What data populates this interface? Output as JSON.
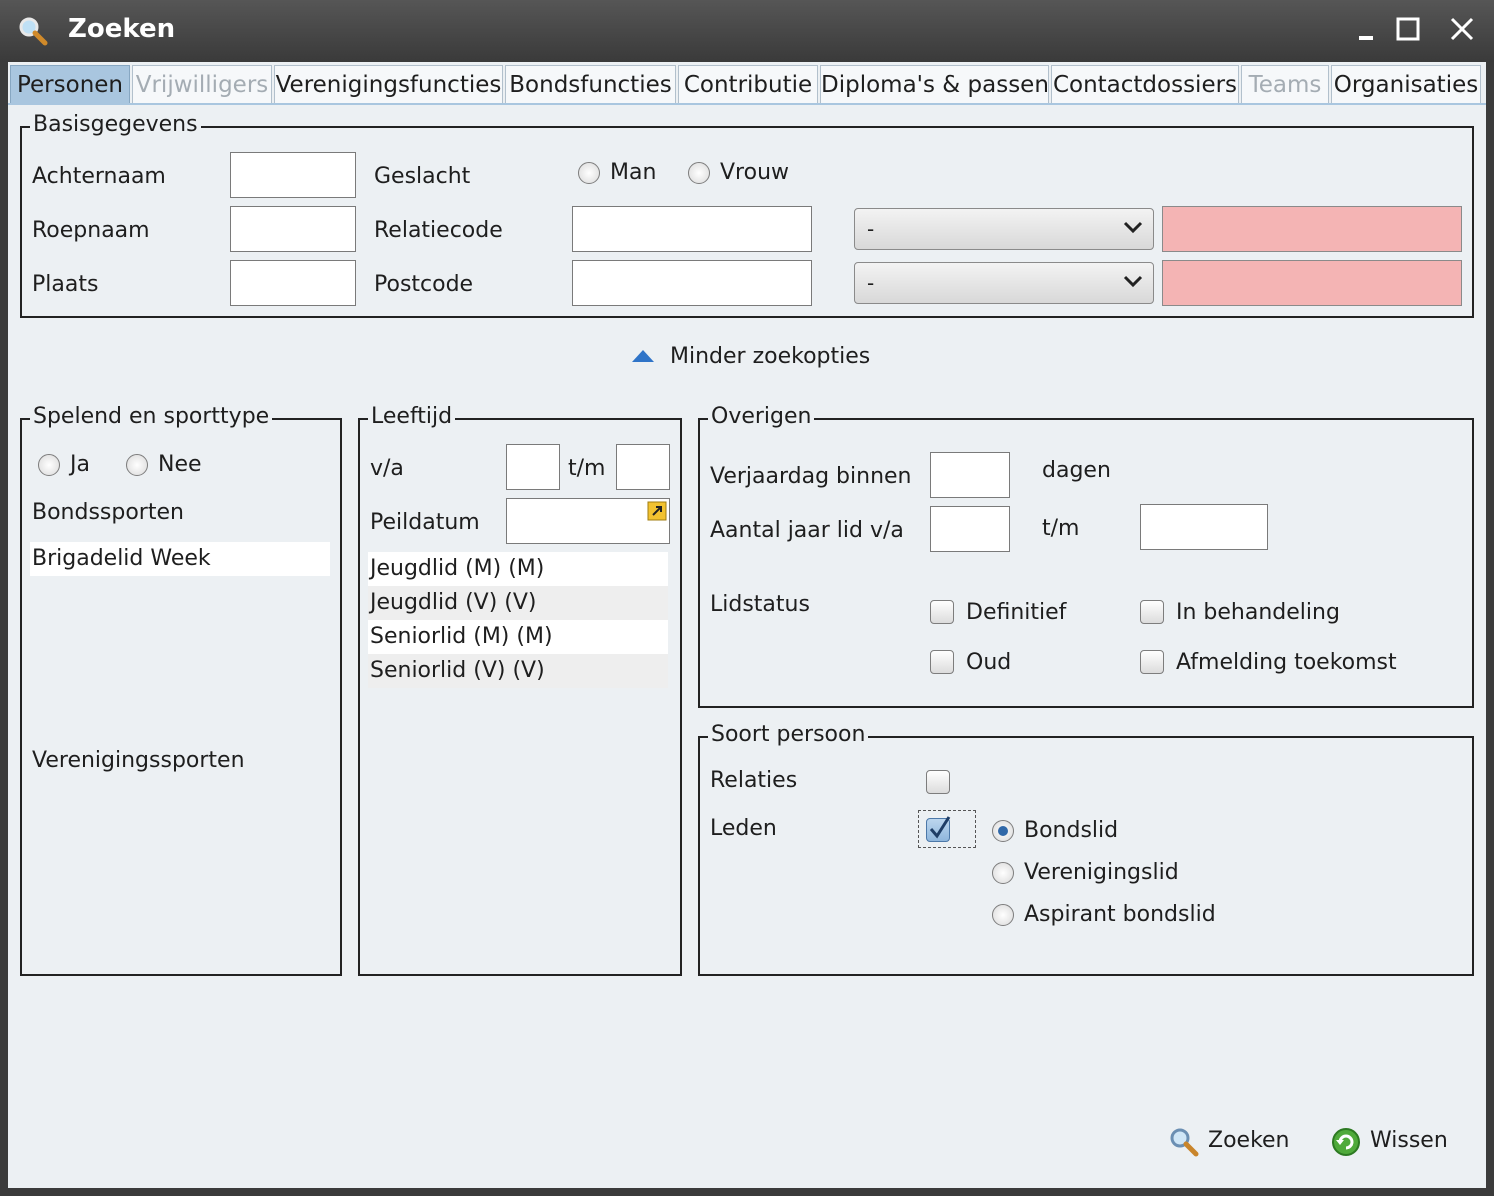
{
  "window": {
    "title": "Zoeken"
  },
  "tabs": [
    {
      "label": "Personen"
    },
    {
      "label": "Vrijwilligers"
    },
    {
      "label": "Verenigingsfuncties"
    },
    {
      "label": "Bondsfuncties"
    },
    {
      "label": "Contributie"
    },
    {
      "label": "Diploma's & passen"
    },
    {
      "label": "Contactdossiers"
    },
    {
      "label": "Teams"
    },
    {
      "label": "Organisaties"
    }
  ],
  "basis": {
    "legend": "Basisgegevens",
    "achternaam": "Achternaam",
    "roepnaam": "Roepnaam",
    "plaats": "Plaats",
    "geslacht": "Geslacht",
    "man": "Man",
    "vrouw": "Vrouw",
    "relatiecode": "Relatiecode",
    "postcode": "Postcode",
    "combo1": "-",
    "combo2": "-"
  },
  "toggle": {
    "label": "Minder zoekopties"
  },
  "spelend": {
    "legend": "Spelend en sporttype",
    "ja": "Ja",
    "nee": "Nee",
    "bondssporten": "Bondssporten",
    "bonds_items": [
      "Brigadelid Week"
    ],
    "verenigingssporten": "Verenigingssporten"
  },
  "leeftijd": {
    "legend": "Leeftijd",
    "va": "v/a",
    "tm": "t/m",
    "peildatum": "Peildatum",
    "items": [
      "Jeugdlid (M) (M)",
      "Jeugdlid (V) (V)",
      "Seniorlid (M) (M)",
      "Seniorlid (V) (V)"
    ]
  },
  "overigen": {
    "legend": "Overigen",
    "verjaardag": "Verjaardag binnen",
    "dagen": "dagen",
    "aantal": "Aantal jaar lid v/a",
    "tm": "t/m",
    "lidstatus": "Lidstatus",
    "definitief": "Definitief",
    "behandeling": "In behandeling",
    "oud": "Oud",
    "afmelding": "Afmelding toekomst"
  },
  "soort": {
    "legend": "Soort persoon",
    "relaties": "Relaties",
    "leden": "Leden",
    "leden_checked": true,
    "bondslid": "Bondslid",
    "verenigingslid": "Verenigingslid",
    "aspirant": "Aspirant bondslid",
    "selected_type": "Bondslid"
  },
  "buttons": {
    "zoeken": "Zoeken",
    "wissen": "Wissen"
  },
  "colors": {
    "pink_field": "#f4b4b4",
    "active_tab": "#a9c6df",
    "background": "#ecf0f3"
  }
}
